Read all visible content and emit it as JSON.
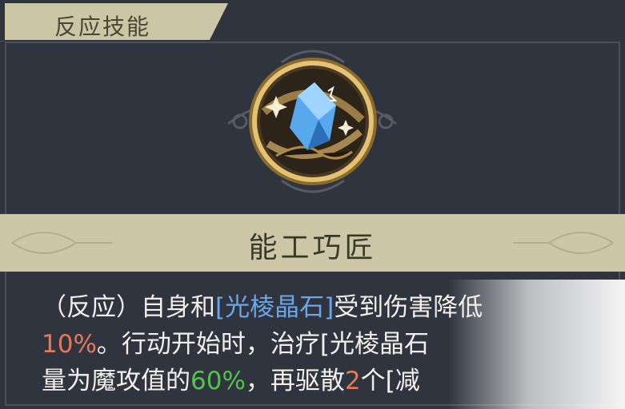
{
  "header": {
    "title": "反应技能"
  },
  "skill": {
    "name": "能工巧匠",
    "icon": "crystal-icon"
  },
  "description": {
    "line1": {
      "a": "（反应）自身和",
      "b": "[光棱晶石]",
      "c": "受到伤害降低"
    },
    "line2": {
      "a": "10%",
      "b": "。行动开始时，治疗",
      "c": "[光棱晶石"
    },
    "line3": {
      "a": "量为魔攻值的",
      "b": "60%",
      "c": "，再驱散",
      "d": "2",
      "e": "个[减"
    }
  },
  "colors": {
    "background": "#30343f",
    "banner": "#cdc7a7",
    "highlight_blue": "#6aa7e6",
    "highlight_red": "#e5795a",
    "highlight_green": "#54c24e"
  }
}
